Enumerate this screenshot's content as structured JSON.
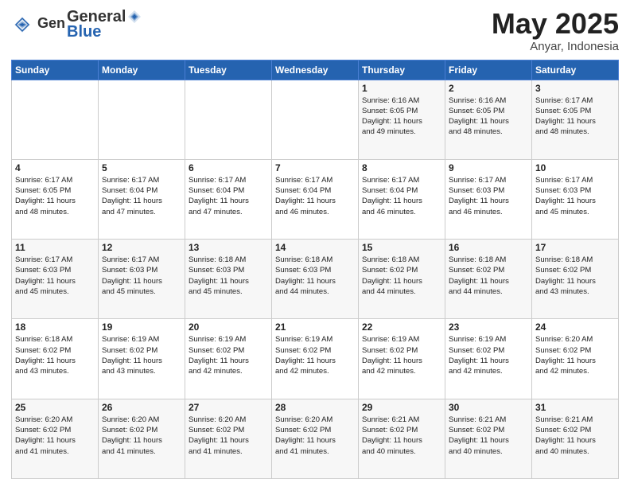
{
  "logo": {
    "general": "General",
    "blue": "Blue"
  },
  "header": {
    "month": "May 2025",
    "location": "Anyar, Indonesia"
  },
  "weekdays": [
    "Sunday",
    "Monday",
    "Tuesday",
    "Wednesday",
    "Thursday",
    "Friday",
    "Saturday"
  ],
  "weeks": [
    [
      {
        "day": "",
        "info": ""
      },
      {
        "day": "",
        "info": ""
      },
      {
        "day": "",
        "info": ""
      },
      {
        "day": "",
        "info": ""
      },
      {
        "day": "1",
        "info": "Sunrise: 6:16 AM\nSunset: 6:05 PM\nDaylight: 11 hours\nand 49 minutes."
      },
      {
        "day": "2",
        "info": "Sunrise: 6:16 AM\nSunset: 6:05 PM\nDaylight: 11 hours\nand 48 minutes."
      },
      {
        "day": "3",
        "info": "Sunrise: 6:17 AM\nSunset: 6:05 PM\nDaylight: 11 hours\nand 48 minutes."
      }
    ],
    [
      {
        "day": "4",
        "info": "Sunrise: 6:17 AM\nSunset: 6:05 PM\nDaylight: 11 hours\nand 48 minutes."
      },
      {
        "day": "5",
        "info": "Sunrise: 6:17 AM\nSunset: 6:04 PM\nDaylight: 11 hours\nand 47 minutes."
      },
      {
        "day": "6",
        "info": "Sunrise: 6:17 AM\nSunset: 6:04 PM\nDaylight: 11 hours\nand 47 minutes."
      },
      {
        "day": "7",
        "info": "Sunrise: 6:17 AM\nSunset: 6:04 PM\nDaylight: 11 hours\nand 46 minutes."
      },
      {
        "day": "8",
        "info": "Sunrise: 6:17 AM\nSunset: 6:04 PM\nDaylight: 11 hours\nand 46 minutes."
      },
      {
        "day": "9",
        "info": "Sunrise: 6:17 AM\nSunset: 6:03 PM\nDaylight: 11 hours\nand 46 minutes."
      },
      {
        "day": "10",
        "info": "Sunrise: 6:17 AM\nSunset: 6:03 PM\nDaylight: 11 hours\nand 45 minutes."
      }
    ],
    [
      {
        "day": "11",
        "info": "Sunrise: 6:17 AM\nSunset: 6:03 PM\nDaylight: 11 hours\nand 45 minutes."
      },
      {
        "day": "12",
        "info": "Sunrise: 6:17 AM\nSunset: 6:03 PM\nDaylight: 11 hours\nand 45 minutes."
      },
      {
        "day": "13",
        "info": "Sunrise: 6:18 AM\nSunset: 6:03 PM\nDaylight: 11 hours\nand 45 minutes."
      },
      {
        "day": "14",
        "info": "Sunrise: 6:18 AM\nSunset: 6:03 PM\nDaylight: 11 hours\nand 44 minutes."
      },
      {
        "day": "15",
        "info": "Sunrise: 6:18 AM\nSunset: 6:02 PM\nDaylight: 11 hours\nand 44 minutes."
      },
      {
        "day": "16",
        "info": "Sunrise: 6:18 AM\nSunset: 6:02 PM\nDaylight: 11 hours\nand 44 minutes."
      },
      {
        "day": "17",
        "info": "Sunrise: 6:18 AM\nSunset: 6:02 PM\nDaylight: 11 hours\nand 43 minutes."
      }
    ],
    [
      {
        "day": "18",
        "info": "Sunrise: 6:18 AM\nSunset: 6:02 PM\nDaylight: 11 hours\nand 43 minutes."
      },
      {
        "day": "19",
        "info": "Sunrise: 6:19 AM\nSunset: 6:02 PM\nDaylight: 11 hours\nand 43 minutes."
      },
      {
        "day": "20",
        "info": "Sunrise: 6:19 AM\nSunset: 6:02 PM\nDaylight: 11 hours\nand 42 minutes."
      },
      {
        "day": "21",
        "info": "Sunrise: 6:19 AM\nSunset: 6:02 PM\nDaylight: 11 hours\nand 42 minutes."
      },
      {
        "day": "22",
        "info": "Sunrise: 6:19 AM\nSunset: 6:02 PM\nDaylight: 11 hours\nand 42 minutes."
      },
      {
        "day": "23",
        "info": "Sunrise: 6:19 AM\nSunset: 6:02 PM\nDaylight: 11 hours\nand 42 minutes."
      },
      {
        "day": "24",
        "info": "Sunrise: 6:20 AM\nSunset: 6:02 PM\nDaylight: 11 hours\nand 42 minutes."
      }
    ],
    [
      {
        "day": "25",
        "info": "Sunrise: 6:20 AM\nSunset: 6:02 PM\nDaylight: 11 hours\nand 41 minutes."
      },
      {
        "day": "26",
        "info": "Sunrise: 6:20 AM\nSunset: 6:02 PM\nDaylight: 11 hours\nand 41 minutes."
      },
      {
        "day": "27",
        "info": "Sunrise: 6:20 AM\nSunset: 6:02 PM\nDaylight: 11 hours\nand 41 minutes."
      },
      {
        "day": "28",
        "info": "Sunrise: 6:20 AM\nSunset: 6:02 PM\nDaylight: 11 hours\nand 41 minutes."
      },
      {
        "day": "29",
        "info": "Sunrise: 6:21 AM\nSunset: 6:02 PM\nDaylight: 11 hours\nand 40 minutes."
      },
      {
        "day": "30",
        "info": "Sunrise: 6:21 AM\nSunset: 6:02 PM\nDaylight: 11 hours\nand 40 minutes."
      },
      {
        "day": "31",
        "info": "Sunrise: 6:21 AM\nSunset: 6:02 PM\nDaylight: 11 hours\nand 40 minutes."
      }
    ]
  ]
}
